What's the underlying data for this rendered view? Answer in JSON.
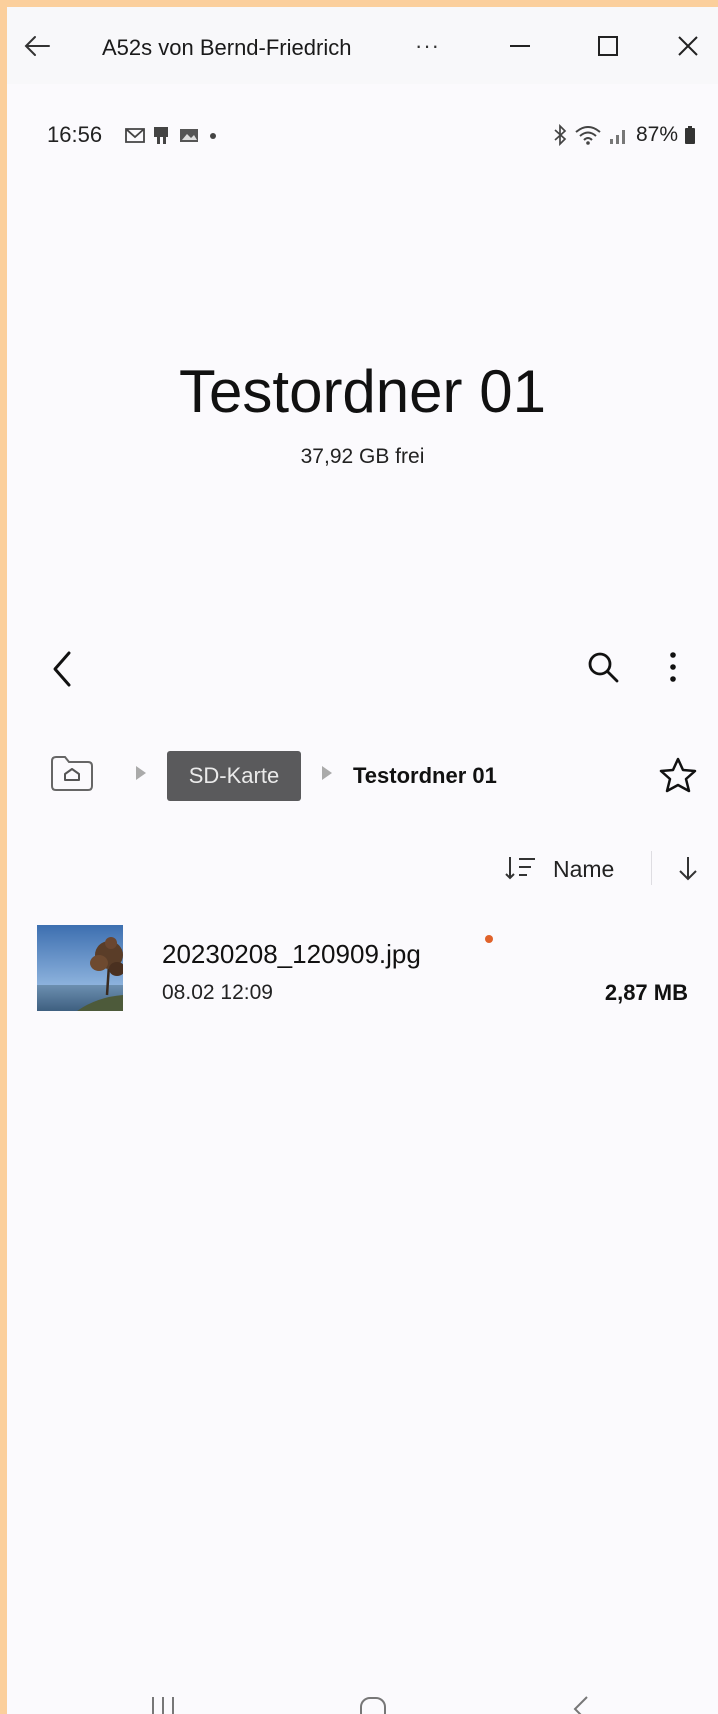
{
  "window": {
    "title": "A52s von Bernd-Friedrich",
    "more_label": "···"
  },
  "status_bar": {
    "time": "16:56",
    "battery": "87%"
  },
  "header": {
    "folder_title": "Testordner 01",
    "free_space": "37,92 GB frei"
  },
  "breadcrumb": {
    "items": [
      "SD-Karte",
      "Testordner 01"
    ]
  },
  "sort": {
    "label": "Name"
  },
  "files": [
    {
      "name": "20230208_120909.jpg",
      "date": "08.02 12:09",
      "size": "2,87 MB"
    }
  ],
  "colors": {
    "accent_border": "#fbcf9c",
    "background": "#fbfafd",
    "breadcrumb_chip": "#5a5a5c",
    "new_dot": "#e0622a"
  },
  "icons": {
    "window": [
      "back-arrow-icon",
      "more-icon",
      "minimize-icon",
      "maximize-icon",
      "close-icon"
    ],
    "toolbar": [
      "chevron-left-icon",
      "search-icon",
      "more-vertical-icon"
    ],
    "breadcrumb": [
      "home-folder-icon",
      "triangle-right-icon",
      "star-icon"
    ],
    "nav": [
      "recents-icon",
      "home-icon",
      "back-icon"
    ]
  }
}
